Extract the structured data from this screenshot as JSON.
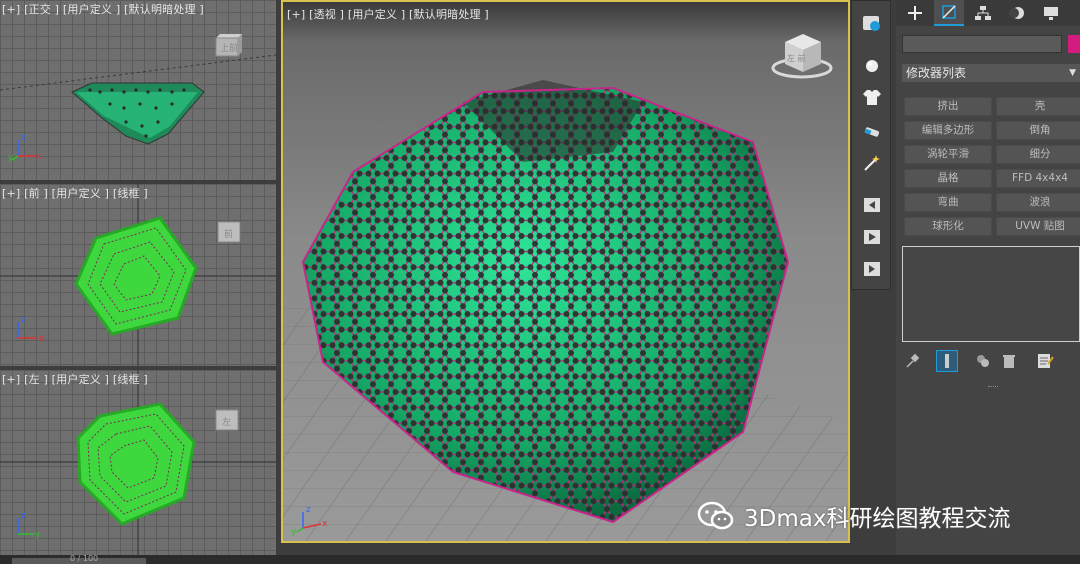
{
  "viewports": {
    "top": {
      "label": "[+] [正交 ] [用户定义 ] [默认明暗处理 ]",
      "cube_label": "上前"
    },
    "front": {
      "label": "[+] [前 ] [用户定义 ] [线框 ]",
      "cube_label": "前"
    },
    "left": {
      "label": "[+] [左 ] [用户定义 ] [线框 ]",
      "cube_label": "左"
    },
    "perspective": {
      "label": "[+] [透视 ] [用户定义 ] [默认明暗处理 ]",
      "cube_label": "左 前"
    }
  },
  "axes": {
    "x": "x",
    "y": "y",
    "z": "z"
  },
  "timeline": {
    "frame": "0 / 100"
  },
  "toolbar_icons": [
    "sphere-icon",
    "shirt-icon",
    "brush-icon",
    "sparkle-icon",
    "key-left-icon",
    "play-icon",
    "key-right-icon"
  ],
  "command_panel": {
    "tabs": [
      "create-tab",
      "modify-tab",
      "hierarchy-tab",
      "motion-tab",
      "display-tab"
    ],
    "object_name": "",
    "object_color": "#d21c80",
    "modifier_list_label": "修改器列表",
    "modifier_buttons": [
      "挤出",
      "壳",
      "编辑多边形",
      "倒角",
      "涡轮平滑",
      "细分",
      "晶格",
      "FFD 4x4x4",
      "弯曲",
      "波浪",
      "球形化",
      "UVW 贴图"
    ]
  },
  "watermark": {
    "text": "3Dmax科研绘图教程交流"
  },
  "colors": {
    "active_border": "#d8c24c",
    "atom": "#2e2e2e",
    "bond": "#c8248a",
    "core": "#1fbf80",
    "wireframe": "#33cc33"
  }
}
